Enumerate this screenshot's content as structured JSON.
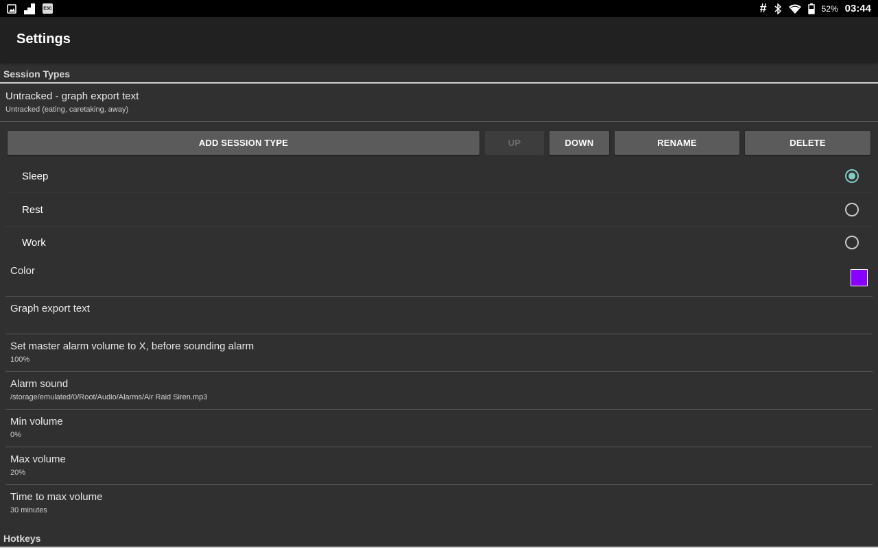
{
  "status_bar": {
    "left_icons": [
      "image-icon",
      "signal-bars-icon",
      "esc-key-icon"
    ],
    "esc_label": "ESC",
    "right_icons": [
      "hash-icon",
      "bluetooth-icon",
      "wifi-icon",
      "battery-icon"
    ],
    "hash_glyph": "#",
    "battery": "52%",
    "time": "03:44"
  },
  "app_bar": {
    "title": "Settings"
  },
  "session_types": {
    "header": "Session Types",
    "current": {
      "title": "Untracked - graph export text",
      "summary": "Untracked (eating, caretaking, away)"
    },
    "buttons": {
      "add": "ADD SESSION TYPE",
      "up": "UP",
      "down": "DOWN",
      "rename": "RENAME",
      "delete": "DELETE"
    },
    "options": [
      {
        "label": "Sleep",
        "selected": true
      },
      {
        "label": "Rest",
        "selected": false
      },
      {
        "label": "Work",
        "selected": false
      }
    ],
    "accent_color": "#80cbc4"
  },
  "prefs": {
    "color": {
      "title": "Color",
      "value": "#8800ff"
    },
    "graph_export": {
      "title": "Graph export text"
    },
    "master_volume": {
      "title": "Set master alarm volume to X, before sounding alarm",
      "summary": "100%"
    },
    "alarm_sound": {
      "title": "Alarm sound",
      "summary": "/storage/emulated/0/Root/Audio/Alarms/Air Raid Siren.mp3"
    },
    "min_volume": {
      "title": "Min volume",
      "summary": "0%"
    },
    "max_volume": {
      "title": "Max volume",
      "summary": "20%"
    },
    "time_to_max": {
      "title": "Time to max volume",
      "summary": "30 minutes"
    }
  },
  "hotkeys": {
    "header": "Hotkeys"
  }
}
